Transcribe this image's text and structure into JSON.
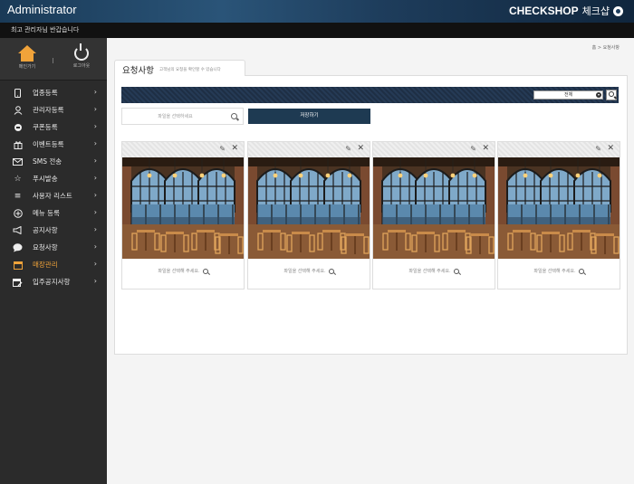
{
  "header": {
    "app_title": "Administrator",
    "logo_text": "CHECKSHOP",
    "logo_sub": "체크샵"
  },
  "subheader": {
    "greeting": "최고 관리자님 반갑습니다"
  },
  "quick_buttons": {
    "home_label": "메인가기",
    "logout_label": "로그아웃"
  },
  "sidebar": {
    "items": [
      {
        "label": "업종등록",
        "icon": "mobile-icon"
      },
      {
        "label": "관리자등록",
        "icon": "user-icon"
      },
      {
        "label": "쿠폰등록",
        "icon": "coupon-icon"
      },
      {
        "label": "이벤트등록",
        "icon": "gift-icon"
      },
      {
        "label": "SMS 전송",
        "icon": "mail-icon"
      },
      {
        "label": "푸시발송",
        "icon": "star-icon"
      },
      {
        "label": "사용자 리스트",
        "icon": "list-icon"
      },
      {
        "label": "메뉴 등록",
        "icon": "plus-circle-icon"
      },
      {
        "label": "공지사항",
        "icon": "megaphone-icon"
      },
      {
        "label": "요청사항",
        "icon": "speech-bubble-icon"
      },
      {
        "label": "매장관리",
        "icon": "calendar-icon"
      },
      {
        "label": "입주공지사항",
        "icon": "calendar-edit-icon"
      }
    ],
    "active_index": 10,
    "accent_color": "#f0a33a"
  },
  "breadcrumb": "홈 > 요청사항",
  "page": {
    "title": "요청사항",
    "subtitle": "고객님의 요청을 확인할 수 있습니다"
  },
  "toolbar": {
    "select_value": "전체"
  },
  "upload": {
    "placeholder": "파일을 선택하세요",
    "save_label": "저장하기"
  },
  "cards": [
    {
      "caption": "파일을 선택해 주세요."
    },
    {
      "caption": "파일을 선택해 주세요."
    },
    {
      "caption": "파일을 선택해 주세요."
    },
    {
      "caption": "파일을 선택해 주세요."
    }
  ]
}
